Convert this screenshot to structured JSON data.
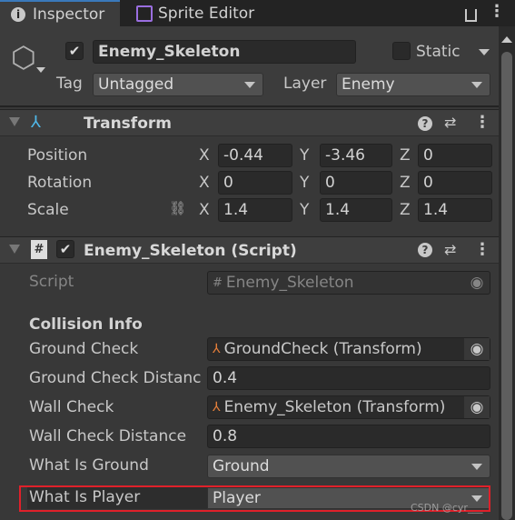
{
  "tabs": [
    {
      "label": "Inspector",
      "icon": "info-icon"
    },
    {
      "label": "Sprite Editor",
      "icon": "sprite-editor-icon"
    }
  ],
  "header": {
    "active": true,
    "name": "Enemy_Skeleton",
    "static_label": "Static",
    "static": false,
    "tag_label": "Tag",
    "tag": "Untagged",
    "layer_label": "Layer",
    "layer": "Enemy"
  },
  "transform": {
    "title": "Transform",
    "rows": [
      {
        "label": "Position",
        "x": "-0.44",
        "y": "-3.46",
        "z": "0"
      },
      {
        "label": "Rotation",
        "x": "0",
        "y": "0",
        "z": "0"
      },
      {
        "label": "Scale",
        "x": "1.4",
        "y": "1.4",
        "z": "1.4"
      }
    ],
    "axes": [
      "X",
      "Y",
      "Z"
    ]
  },
  "script": {
    "title": "Enemy_Skeleton (Script)",
    "script_label": "Script",
    "script_value": "Enemy_Skeleton",
    "section": "Collision Info",
    "ground_check_label": "Ground Check",
    "ground_check": "GroundCheck (Transform)",
    "ground_dist_label": "Ground Check Distanc",
    "ground_dist": "0.4",
    "wall_check_label": "Wall Check",
    "wall_check": "Enemy_Skeleton (Transform)",
    "wall_dist_label": "Wall Check Distance",
    "wall_dist": "0.8",
    "ground_label": "What Is Ground",
    "ground": "Ground",
    "player_label": "What Is Player",
    "player": "Player"
  },
  "highlight_color": "#e0202a",
  "watermark": "CSDN @cyr___"
}
